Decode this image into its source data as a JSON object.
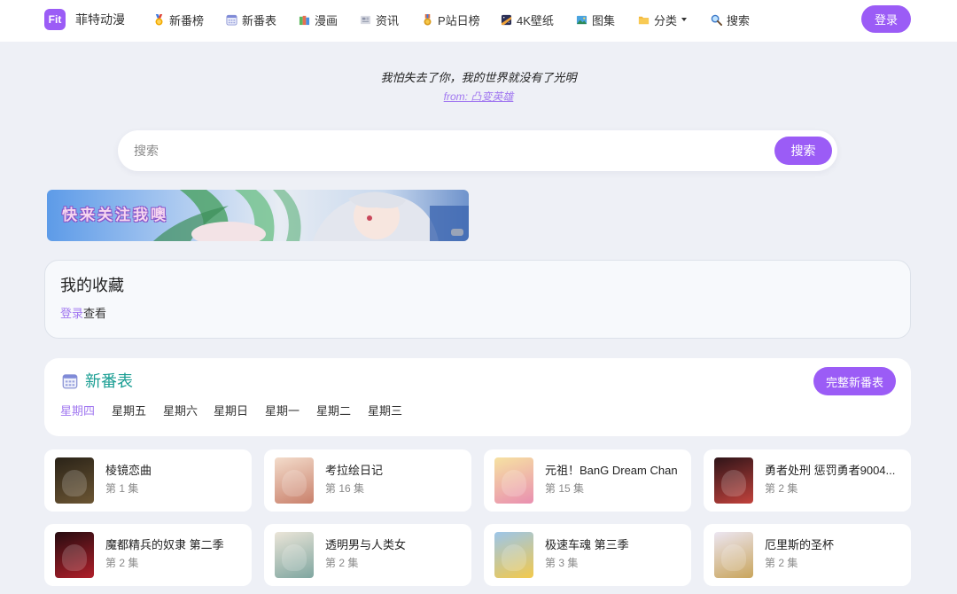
{
  "header": {
    "logo_text": "Fit",
    "site_name": "菲特动漫",
    "nav": [
      {
        "icon": "medal-icon",
        "label": "新番榜"
      },
      {
        "icon": "calendar-icon",
        "label": "新番表"
      },
      {
        "icon": "books-icon",
        "label": "漫画"
      },
      {
        "icon": "newspaper-icon",
        "label": "资讯"
      },
      {
        "icon": "military-medal-icon",
        "label": "P站日榜"
      },
      {
        "icon": "night-sky-icon",
        "label": "4K壁纸"
      },
      {
        "icon": "framed-picture-icon",
        "label": "图集"
      },
      {
        "icon": "folder-icon",
        "label": "分类",
        "has_dropdown": true
      },
      {
        "icon": "search-icon",
        "label": "搜索"
      }
    ],
    "login_label": "登录"
  },
  "quote": {
    "text": "我怕失去了你，我的世界就没有了光明",
    "source": "from: 凸变英雄"
  },
  "search": {
    "placeholder": "搜索",
    "value": "",
    "button_label": "搜索"
  },
  "banner": {
    "text": "快来关注我噢"
  },
  "favorites": {
    "title": "我的收藏",
    "login_link": "登录",
    "login_suffix": "查看"
  },
  "schedule": {
    "icon": "calendar-icon",
    "title": "新番表",
    "full_button": "完整新番表",
    "days": [
      "星期四",
      "星期五",
      "星期六",
      "星期日",
      "星期一",
      "星期二",
      "星期三"
    ],
    "active_day": "星期四",
    "items": [
      {
        "title": "棱镜恋曲",
        "episode": "第 1 集",
        "thumb_colors": [
          "#2a2318",
          "#6b5533"
        ]
      },
      {
        "title": "考拉绘日记",
        "episode": "第 16 集",
        "thumb_colors": [
          "#f3dccb",
          "#c9806b"
        ]
      },
      {
        "title": "元祖！BanG Dream Chan",
        "episode": "第 15 集",
        "thumb_colors": [
          "#f6e2a2",
          "#e98fb0"
        ]
      },
      {
        "title": "勇者处刑 惩罚勇者9004...",
        "episode": "第 2 集",
        "thumb_colors": [
          "#2e1418",
          "#c2423c"
        ]
      },
      {
        "title": "魔都精兵的奴隶 第二季",
        "episode": "第 2 集",
        "thumb_colors": [
          "#260c10",
          "#b01f2a"
        ]
      },
      {
        "title": "透明男与人类女",
        "episode": "第 2 集",
        "thumb_colors": [
          "#ebe5d8",
          "#7fa6a0"
        ]
      },
      {
        "title": "极速车魂 第三季",
        "episode": "第 3 集",
        "thumb_colors": [
          "#9cc6ea",
          "#f2c94c"
        ]
      },
      {
        "title": "厄里斯的圣杯",
        "episode": "第 2 集",
        "thumb_colors": [
          "#ece6f2",
          "#c9a55c"
        ]
      }
    ]
  },
  "colors": {
    "accent": "#9b5cf6",
    "link": "#a178f0",
    "schedule_title": "#1a9e93",
    "page_background": "#eef0f6"
  }
}
